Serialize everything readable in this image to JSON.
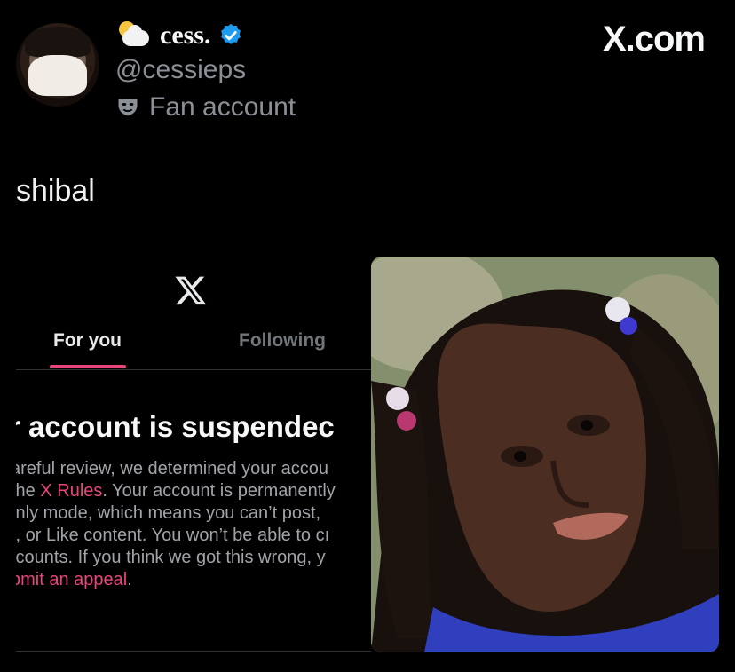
{
  "tweet": {
    "display_name": "cess.",
    "handle": "@cessieps",
    "label": "Fan account",
    "text": "shibal",
    "watermark": "X.com",
    "icons": [
      "sun-behind-cloud-icon",
      "verified-badge-icon",
      "performing-arts-mask-icon"
    ]
  },
  "embedded_screenshot": {
    "tabs": [
      {
        "label": "For you",
        "active": true
      },
      {
        "label": "Following",
        "active": false
      }
    ],
    "title": "r account is suspendec",
    "lines": [
      {
        "before": "areful review, we determined your accou",
        "link": "",
        "after": ""
      },
      {
        "before": "the ",
        "link": "X Rules",
        "after": ". Your account is permanently"
      },
      {
        "before": "ınly mode, which means you can’t post,",
        "link": "",
        "after": ""
      },
      {
        "before": "t, or Like content. You won’t be able to cı",
        "link": "",
        "after": ""
      },
      {
        "before": ":counts. If you think we got this wrong, y",
        "link": "",
        "after": ""
      },
      {
        "before": "",
        "link": "bmit an appeal",
        "after": "."
      }
    ],
    "accent": "#e8457a"
  },
  "colors": {
    "background": "#000000",
    "secondary_text": "#8b9096",
    "verified_blue": "#1d9bf0"
  }
}
